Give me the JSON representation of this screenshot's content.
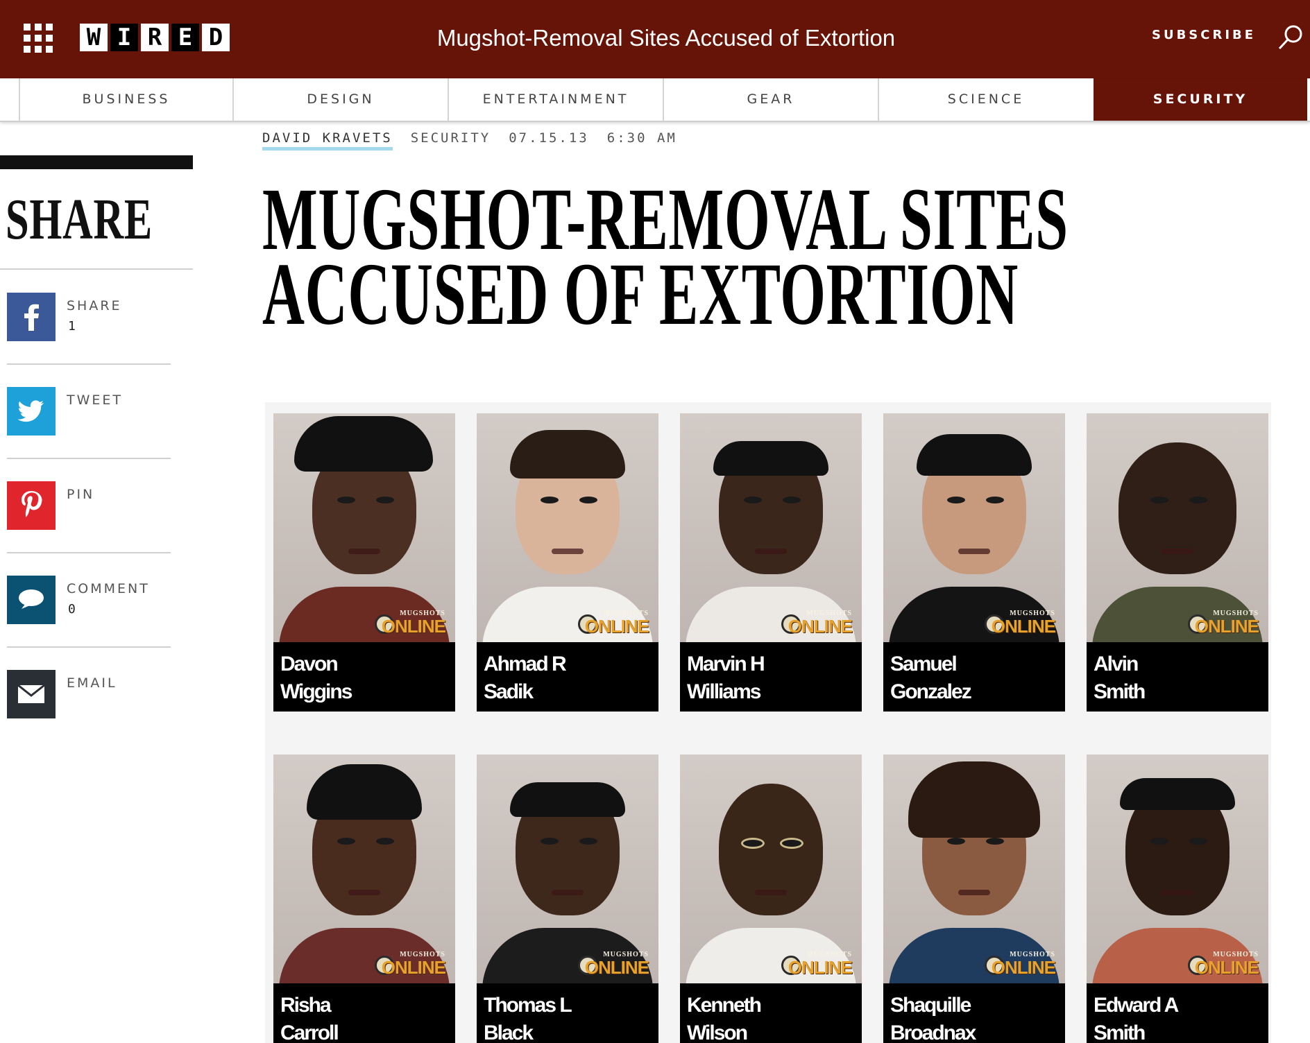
{
  "header": {
    "logo_letters": [
      "W",
      "I",
      "R",
      "E",
      "D"
    ],
    "title": "Mugshot-Removal Sites Accused of Extortion",
    "subscribe_label": "SUBSCRIBE",
    "menu_icon": "grid-menu-icon",
    "search_icon": "search-icon",
    "background_color": "#661308"
  },
  "nav": {
    "items": [
      {
        "label": "BUSINESS"
      },
      {
        "label": "DESIGN"
      },
      {
        "label": "ENTERTAINMENT"
      },
      {
        "label": "GEAR"
      },
      {
        "label": "SCIENCE"
      },
      {
        "label": "SECURITY"
      }
    ],
    "active": "SECURITY"
  },
  "meta": {
    "author": "DAVID KRAVETS",
    "section": "SECURITY",
    "date": "07.15.13",
    "time": "6:30 AM"
  },
  "share": {
    "title": "SHARE",
    "items": [
      {
        "label": "SHARE",
        "count": "1",
        "icon": "facebook-icon",
        "color": "#3b5998"
      },
      {
        "label": "TWEET",
        "count": "",
        "icon": "twitter-icon",
        "color": "#1da1d8"
      },
      {
        "label": "PIN",
        "count": "",
        "icon": "pinterest-icon",
        "color": "#e0262c"
      },
      {
        "label": "COMMENT",
        "count": "0",
        "icon": "comment-icon",
        "color": "#0b5272"
      },
      {
        "label": "EMAIL",
        "count": "",
        "icon": "email-icon",
        "color": "#2a2f35"
      }
    ]
  },
  "article": {
    "headline": "MUGSHOT-REMOVAL SITES ACCUSED OF EXTORTION"
  },
  "gallery": {
    "watermark_top": "MUGSHOTS",
    "watermark_bottom": "ONLINE",
    "people": [
      {
        "name": "Davon\nWiggins"
      },
      {
        "name": "Ahmad R\nSadik"
      },
      {
        "name": "Marvin H\nWilliams"
      },
      {
        "name": "Samuel\nGonzalez"
      },
      {
        "name": "Alvin\nSmith"
      },
      {
        "name": "Risha\nCarroll"
      },
      {
        "name": "Thomas L\nBlack"
      },
      {
        "name": "Kenneth\nWilson"
      },
      {
        "name": "Shaquille\nBroadnax"
      },
      {
        "name": "Edward A\nSmith"
      }
    ]
  }
}
